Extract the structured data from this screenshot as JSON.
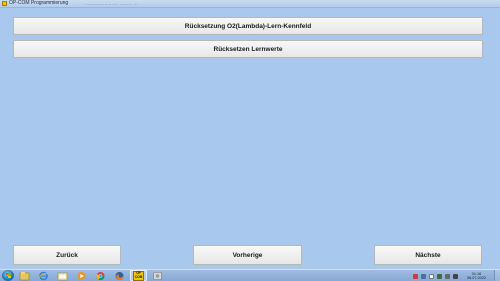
{
  "window": {
    "title": "OP-COM Programmierung",
    "faint_caption": "........................ ......... ..."
  },
  "main": {
    "buttons": [
      {
        "label": "Rücksetzung O2(Lambda)-Lern-Kennfeld"
      },
      {
        "label": "Rücksetzen Lernwerte"
      }
    ]
  },
  "footer": {
    "back_label": "Zurück",
    "previous_label": "Vorherige",
    "next_label": "Nächste"
  },
  "taskbar": {
    "pinned": [
      "start-orb",
      "explorer",
      "internet-explorer",
      "folder",
      "media-player",
      "chrome",
      "firefox",
      "opcom",
      "settings"
    ],
    "opcom_label_1": "OP",
    "opcom_label_2": "COM",
    "clock_time": "01:16",
    "clock_date": "06.07.2022"
  },
  "colors": {
    "background": "#a8c8ee",
    "button": "#efefef",
    "taskbar": "#8fb2da"
  }
}
